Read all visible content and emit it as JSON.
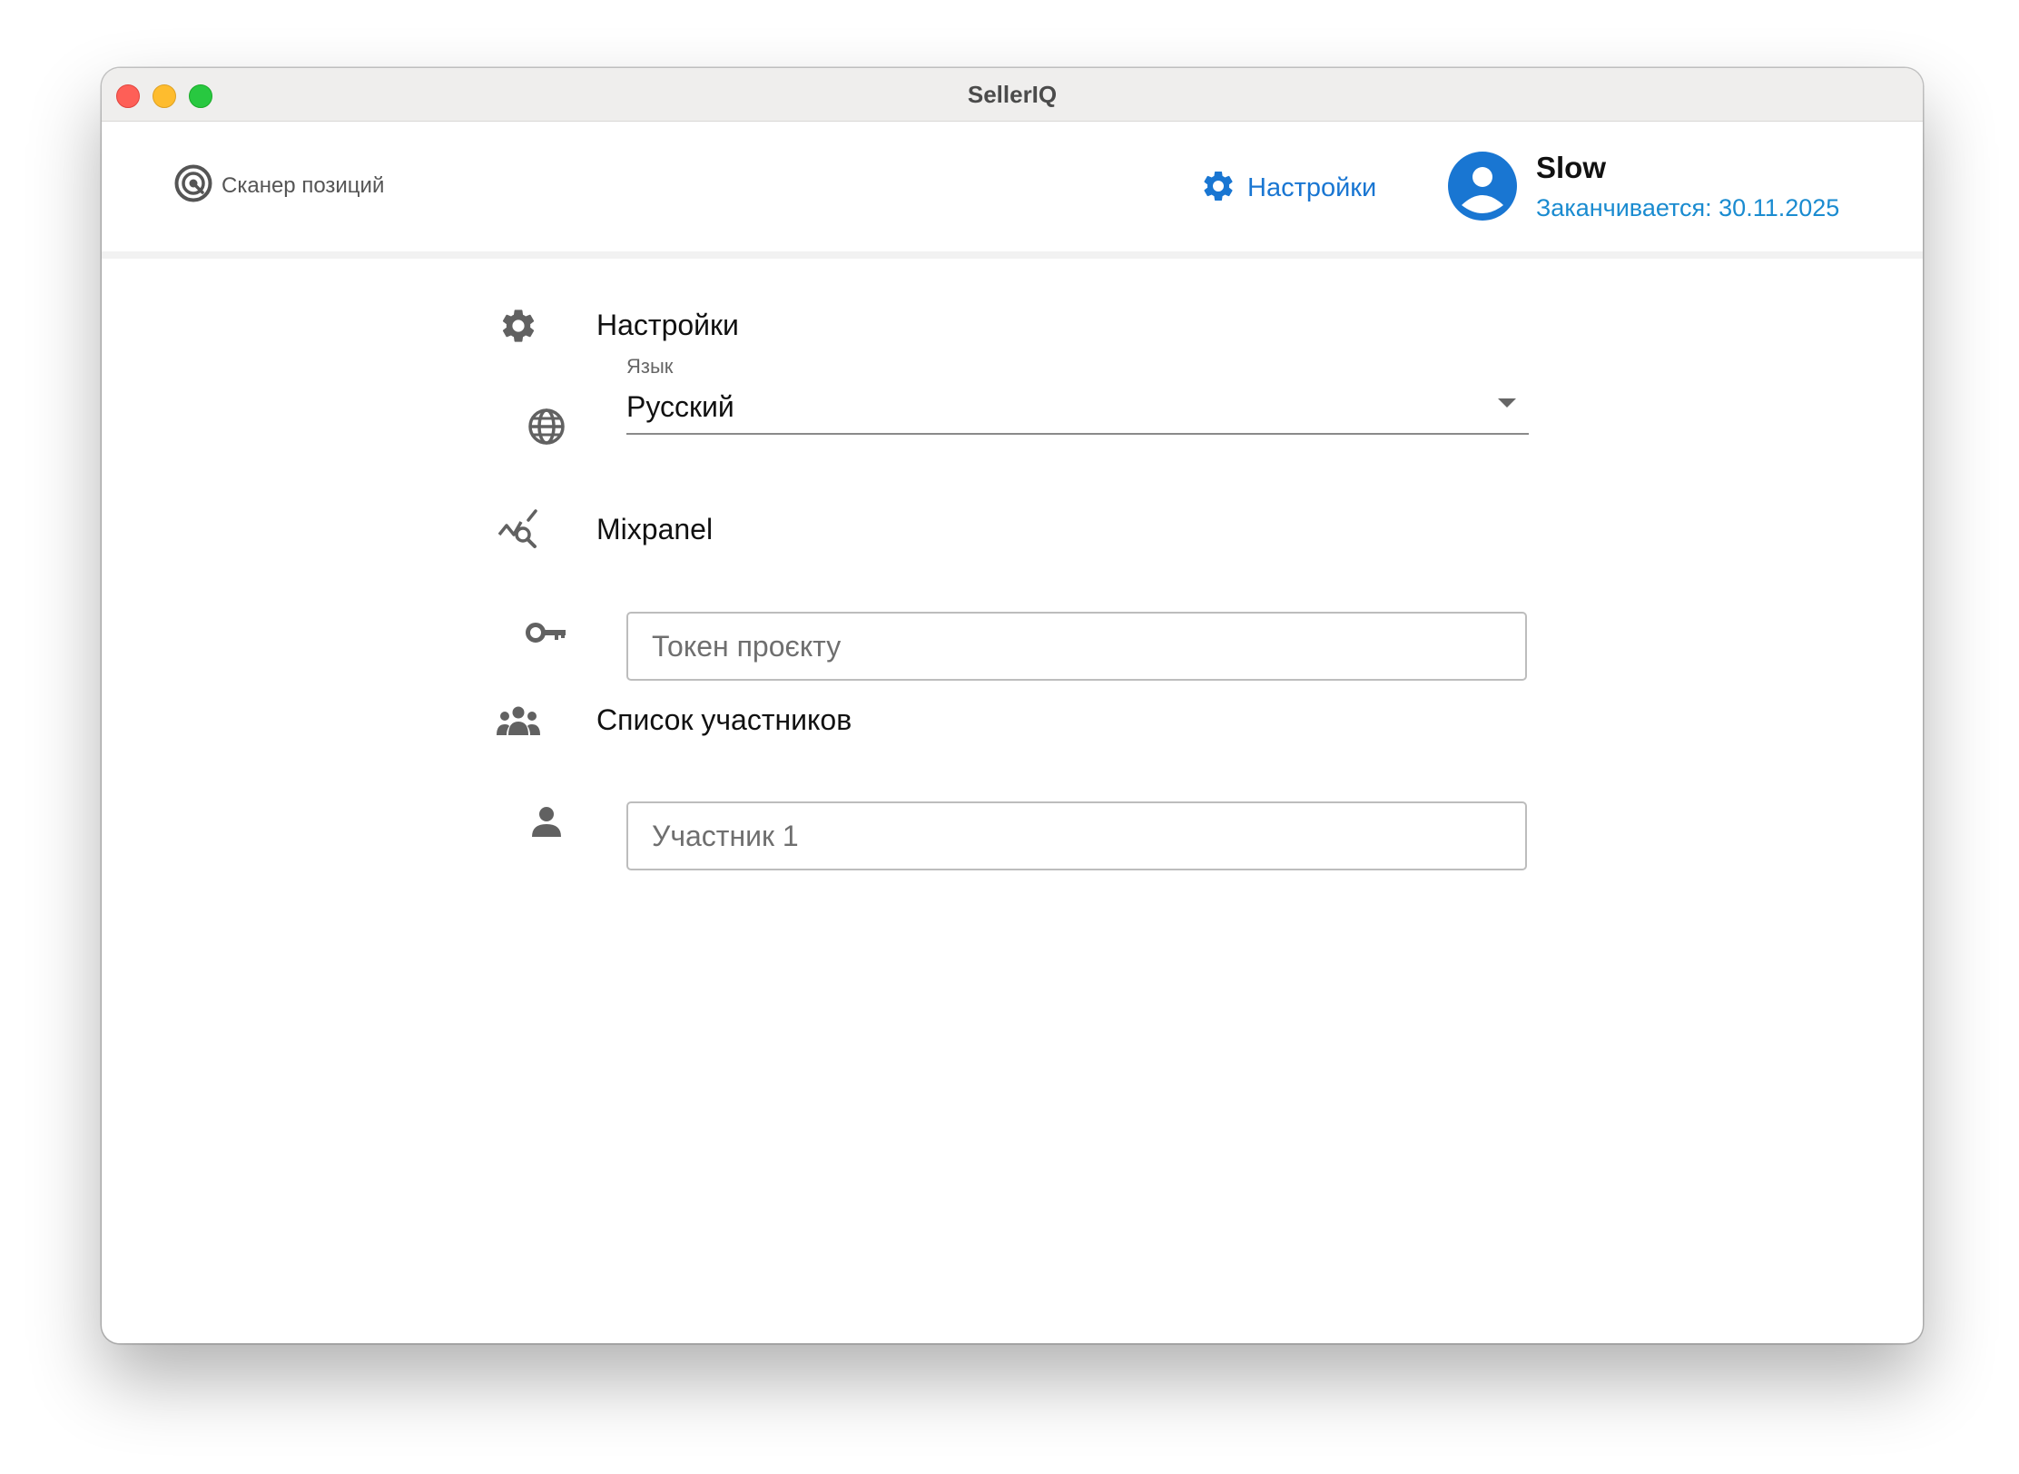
{
  "window": {
    "title": "SellerIQ",
    "controls": [
      "close",
      "minimize",
      "maximize"
    ]
  },
  "header": {
    "nav_scanner": {
      "icon": "target-icon",
      "label": "Сканер позиций"
    },
    "nav_settings": {
      "icon": "gear-icon",
      "label": "Настройки"
    },
    "user": {
      "avatar_icon": "account-circle-icon",
      "name": "Slow",
      "expires": "Заканчивается: 30.11.2025"
    }
  },
  "settings": {
    "section": {
      "icon": "gear-icon",
      "title": "Настройки"
    },
    "language": {
      "icon": "globe-icon",
      "label": "Язык",
      "value": "Русский"
    }
  },
  "mixpanel": {
    "section": {
      "icon": "analytics-icon",
      "title": "Mixpanel"
    },
    "token": {
      "icon": "key-icon",
      "placeholder": "Токен проєкту"
    }
  },
  "participants": {
    "section": {
      "icon": "group-icon",
      "title": "Список участников"
    },
    "participant_1": {
      "icon": "person-icon",
      "placeholder": "Участник 1"
    }
  },
  "colors": {
    "accent": "#1976d2",
    "expires": "#1a8bd0",
    "icon_grey": "#616161"
  }
}
